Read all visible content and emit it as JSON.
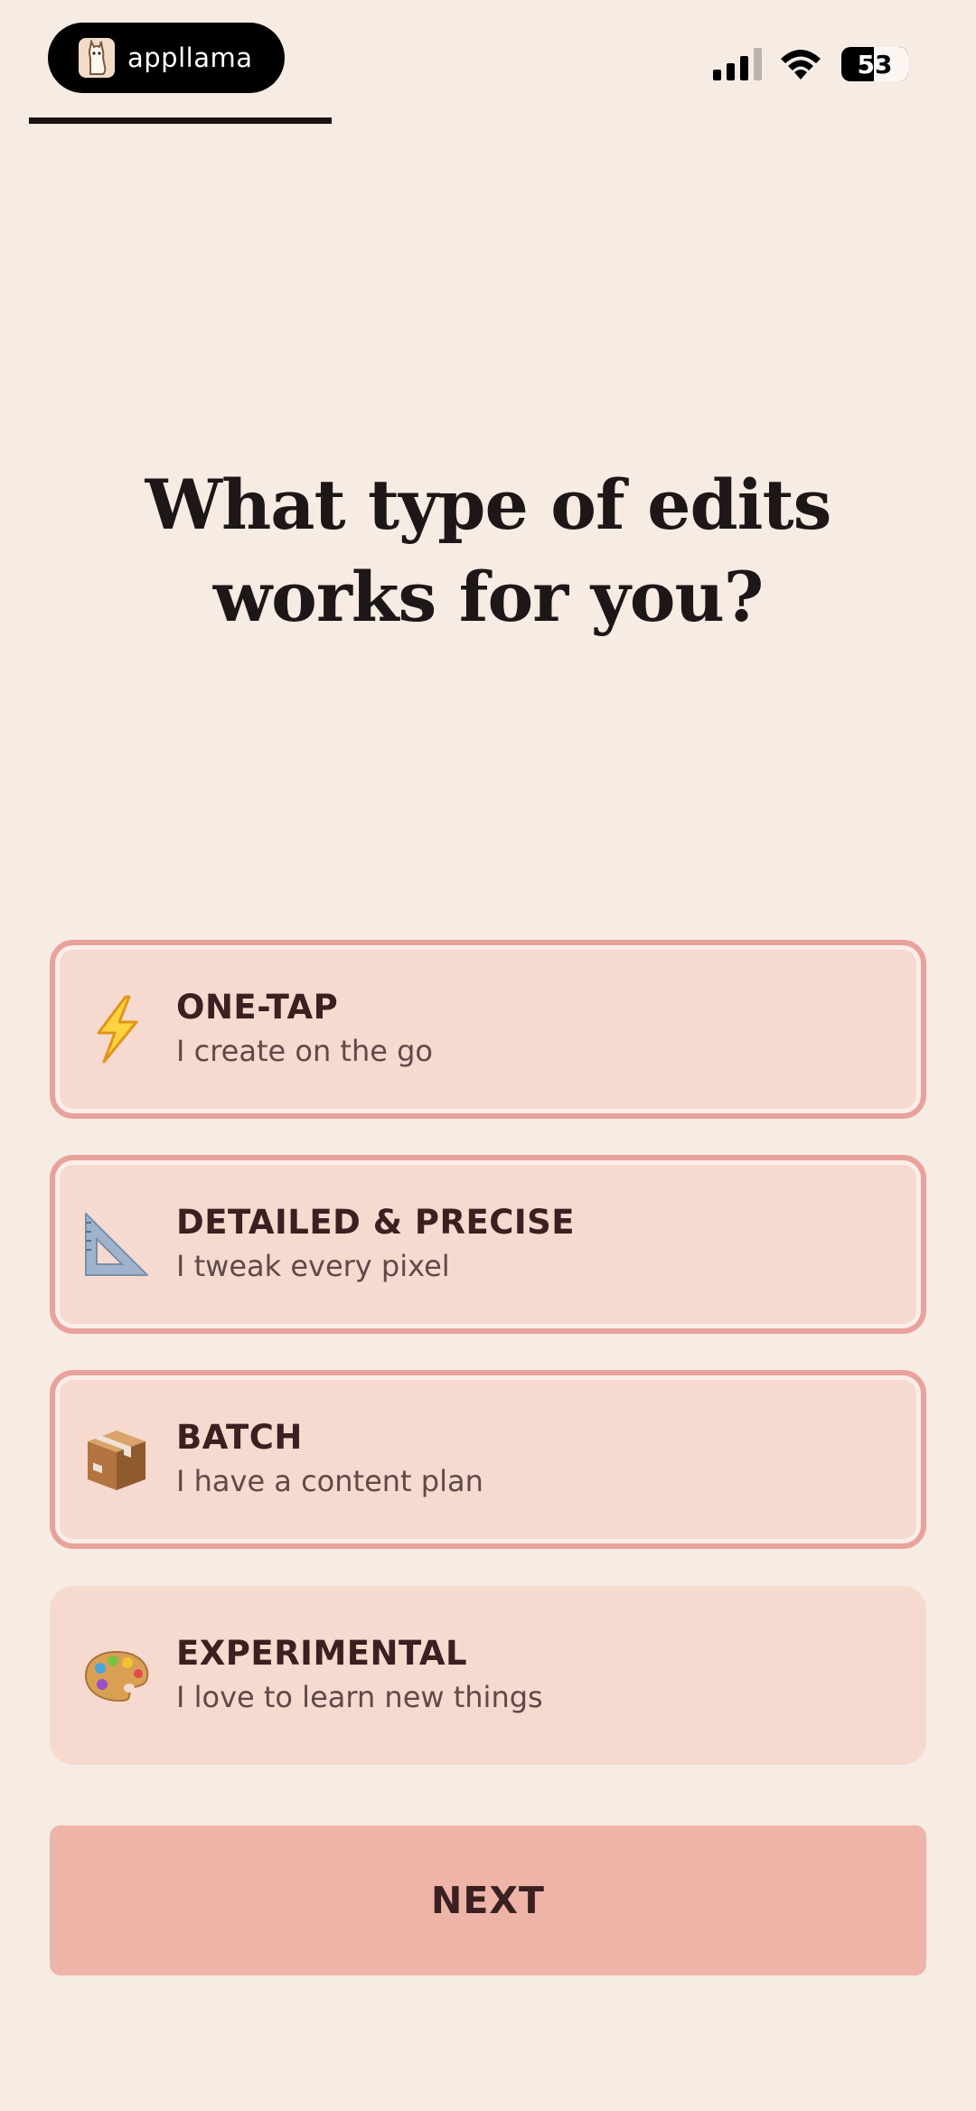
{
  "status_bar": {
    "app_name": "appllama",
    "battery": "53"
  },
  "progress": {
    "fraction": 0.33
  },
  "question": {
    "title": "What type of edits works for you?"
  },
  "options": [
    {
      "title": "ONE-TAP",
      "subtitle": "I create on the go",
      "icon": "lightning-icon",
      "selected": true
    },
    {
      "title": "DETAILED & PRECISE",
      "subtitle": "I tweak every pixel",
      "icon": "set-square-icon",
      "selected": true
    },
    {
      "title": "BATCH",
      "subtitle": "I have a content plan",
      "icon": "package-icon",
      "selected": true
    },
    {
      "title": "EXPERIMENTAL",
      "subtitle": "I love to learn new things",
      "icon": "palette-icon",
      "selected": false
    }
  ],
  "next_button": {
    "label": "NEXT"
  },
  "colors": {
    "background": "#f6ece4",
    "option_fill": "#f6d9cf",
    "selected_border": "#e8a29b",
    "button_fill": "#eeb4a8",
    "text_dark": "#3a2020"
  }
}
